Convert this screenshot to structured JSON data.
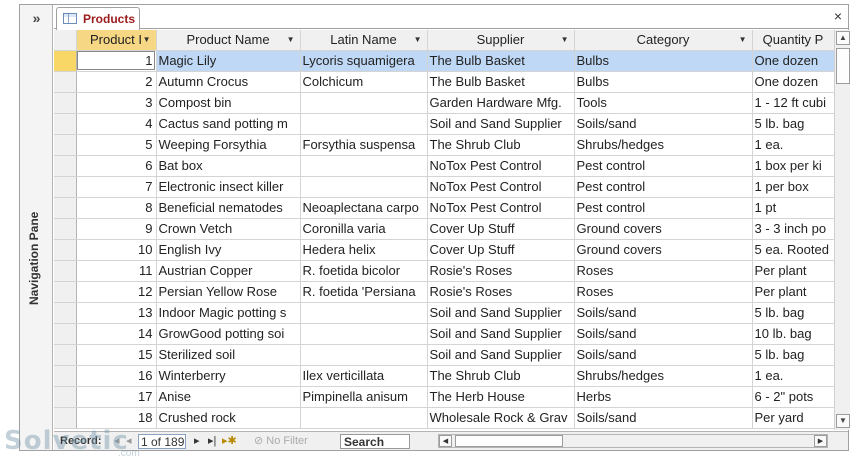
{
  "navigation_pane": {
    "toggle": "»",
    "label": "Navigation Pane"
  },
  "tab": {
    "label": "Products",
    "close": "×"
  },
  "columns": [
    {
      "label": "Product I",
      "sorted": true
    },
    {
      "label": "Product Name"
    },
    {
      "label": "Latin Name"
    },
    {
      "label": "Supplier"
    },
    {
      "label": "Category"
    },
    {
      "label": "Quantity P"
    }
  ],
  "rows": [
    {
      "id": "1",
      "name": "Magic Lily",
      "latin": "Lycoris squamigera",
      "supplier": "The Bulb Basket",
      "category": "Bulbs",
      "qty": "One dozen"
    },
    {
      "id": "2",
      "name": "Autumn Crocus",
      "latin": "Colchicum",
      "supplier": "The Bulb Basket",
      "category": "Bulbs",
      "qty": "One dozen"
    },
    {
      "id": "3",
      "name": "Compost bin",
      "latin": "",
      "supplier": "Garden Hardware Mfg.",
      "category": "Tools",
      "qty": "1 - 12 ft cubi"
    },
    {
      "id": "4",
      "name": "Cactus sand potting m",
      "latin": "",
      "supplier": "Soil and Sand Supplier",
      "category": "Soils/sand",
      "qty": "5 lb. bag"
    },
    {
      "id": "5",
      "name": "Weeping Forsythia",
      "latin": "Forsythia suspensa",
      "supplier": "The Shrub Club",
      "category": "Shrubs/hedges",
      "qty": "1 ea."
    },
    {
      "id": "6",
      "name": "Bat box",
      "latin": "",
      "supplier": "NoTox Pest Control",
      "category": "Pest control",
      "qty": "1 box per ki"
    },
    {
      "id": "7",
      "name": "Electronic insect killer",
      "latin": "",
      "supplier": "NoTox Pest Control",
      "category": "Pest control",
      "qty": "1 per box"
    },
    {
      "id": "8",
      "name": "Beneficial nematodes",
      "latin": "Neoaplectana carpo",
      "supplier": "NoTox Pest Control",
      "category": "Pest control",
      "qty": "1 pt"
    },
    {
      "id": "9",
      "name": "Crown Vetch",
      "latin": "Coronilla varia",
      "supplier": "Cover Up Stuff",
      "category": "Ground covers",
      "qty": "3 - 3 inch po"
    },
    {
      "id": "10",
      "name": "English Ivy",
      "latin": "Hedera helix",
      "supplier": "Cover Up Stuff",
      "category": "Ground covers",
      "qty": "5 ea. Rooted"
    },
    {
      "id": "11",
      "name": "Austrian Copper",
      "latin": "R. foetida bicolor",
      "supplier": "Rosie's Roses",
      "category": "Roses",
      "qty": "Per plant"
    },
    {
      "id": "12",
      "name": "Persian Yellow Rose",
      "latin": "R. foetida 'Persiana",
      "supplier": "Rosie's Roses",
      "category": "Roses",
      "qty": "Per plant"
    },
    {
      "id": "13",
      "name": "Indoor Magic potting s",
      "latin": "",
      "supplier": "Soil and Sand Supplier",
      "category": "Soils/sand",
      "qty": "5 lb. bag"
    },
    {
      "id": "14",
      "name": "GrowGood potting soi",
      "latin": "",
      "supplier": "Soil and Sand Supplier",
      "category": "Soils/sand",
      "qty": "10 lb. bag"
    },
    {
      "id": "15",
      "name": "Sterilized soil",
      "latin": "",
      "supplier": "Soil and Sand Supplier",
      "category": "Soils/sand",
      "qty": "5 lb. bag"
    },
    {
      "id": "16",
      "name": "Winterberry",
      "latin": "Ilex verticillata",
      "supplier": "The Shrub Club",
      "category": "Shrubs/hedges",
      "qty": "1 ea."
    },
    {
      "id": "17",
      "name": "Anise",
      "latin": "Pimpinella anisum",
      "supplier": "The Herb House",
      "category": "Herbs",
      "qty": "6 - 2\" pots"
    },
    {
      "id": "18",
      "name": "Crushed rock",
      "latin": "",
      "supplier": "Wholesale Rock & Grav",
      "category": "Soils/sand",
      "qty": "Per yard"
    }
  ],
  "record_nav": {
    "label": "Record:",
    "position": "1 of 189",
    "filter": "No Filter",
    "search": "Search"
  },
  "watermark": {
    "brand": "Solvetic",
    "sub": ".com"
  },
  "colors": {
    "selected_row": "#bfd8f5",
    "sorted_header": "#f5d784",
    "tab_label": "#9b1b1b"
  }
}
